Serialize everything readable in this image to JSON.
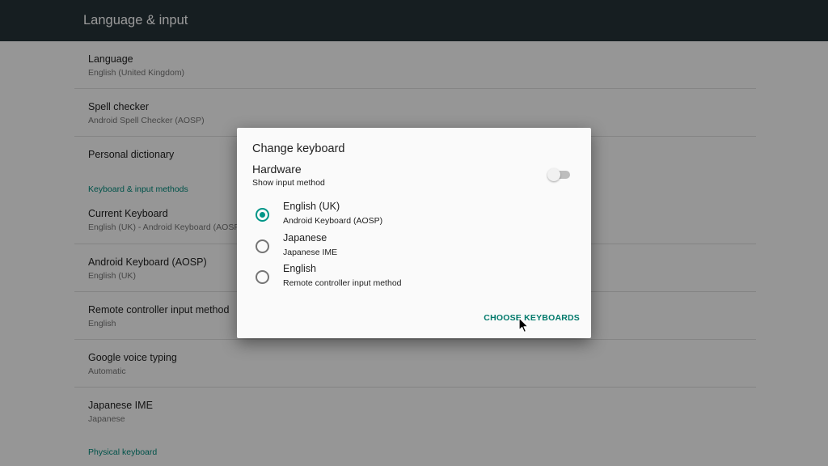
{
  "appbar": {
    "title": "Language & input"
  },
  "settings": {
    "language": {
      "title": "Language",
      "summary": "English (United Kingdom)"
    },
    "spell_checker": {
      "title": "Spell checker",
      "summary": "Android Spell Checker (AOSP)"
    },
    "personal_dictionary": {
      "title": "Personal dictionary"
    },
    "keyboard_header": "Keyboard & input methods",
    "current_keyboard": {
      "title": "Current Keyboard",
      "summary": "English (UK) - Android Keyboard (AOSP)"
    },
    "android_keyboard": {
      "title": "Android Keyboard (AOSP)",
      "summary": "English (UK)"
    },
    "remote_controller": {
      "title": "Remote controller input method",
      "summary": "English"
    },
    "google_voice": {
      "title": "Google voice typing",
      "summary": "Automatic"
    },
    "japanese_ime": {
      "title": "Japanese IME",
      "summary": "Japanese"
    },
    "physical_header": "Physical keyboard"
  },
  "dialog": {
    "title": "Change keyboard",
    "hardware_title": "Hardware",
    "hardware_summary": "Show input method",
    "show_input_method_on": false,
    "options": [
      {
        "title": "English (UK)",
        "summary": "Android Keyboard (AOSP)",
        "selected": true
      },
      {
        "title": "Japanese",
        "summary": "Japanese IME",
        "selected": false
      },
      {
        "title": "English",
        "summary": "Remote controller input method",
        "selected": false
      }
    ],
    "choose_label": "CHOOSE KEYBOARDS"
  },
  "colors": {
    "appbar": "#263238",
    "accent": "#009688",
    "accent_text": "#00796b"
  }
}
